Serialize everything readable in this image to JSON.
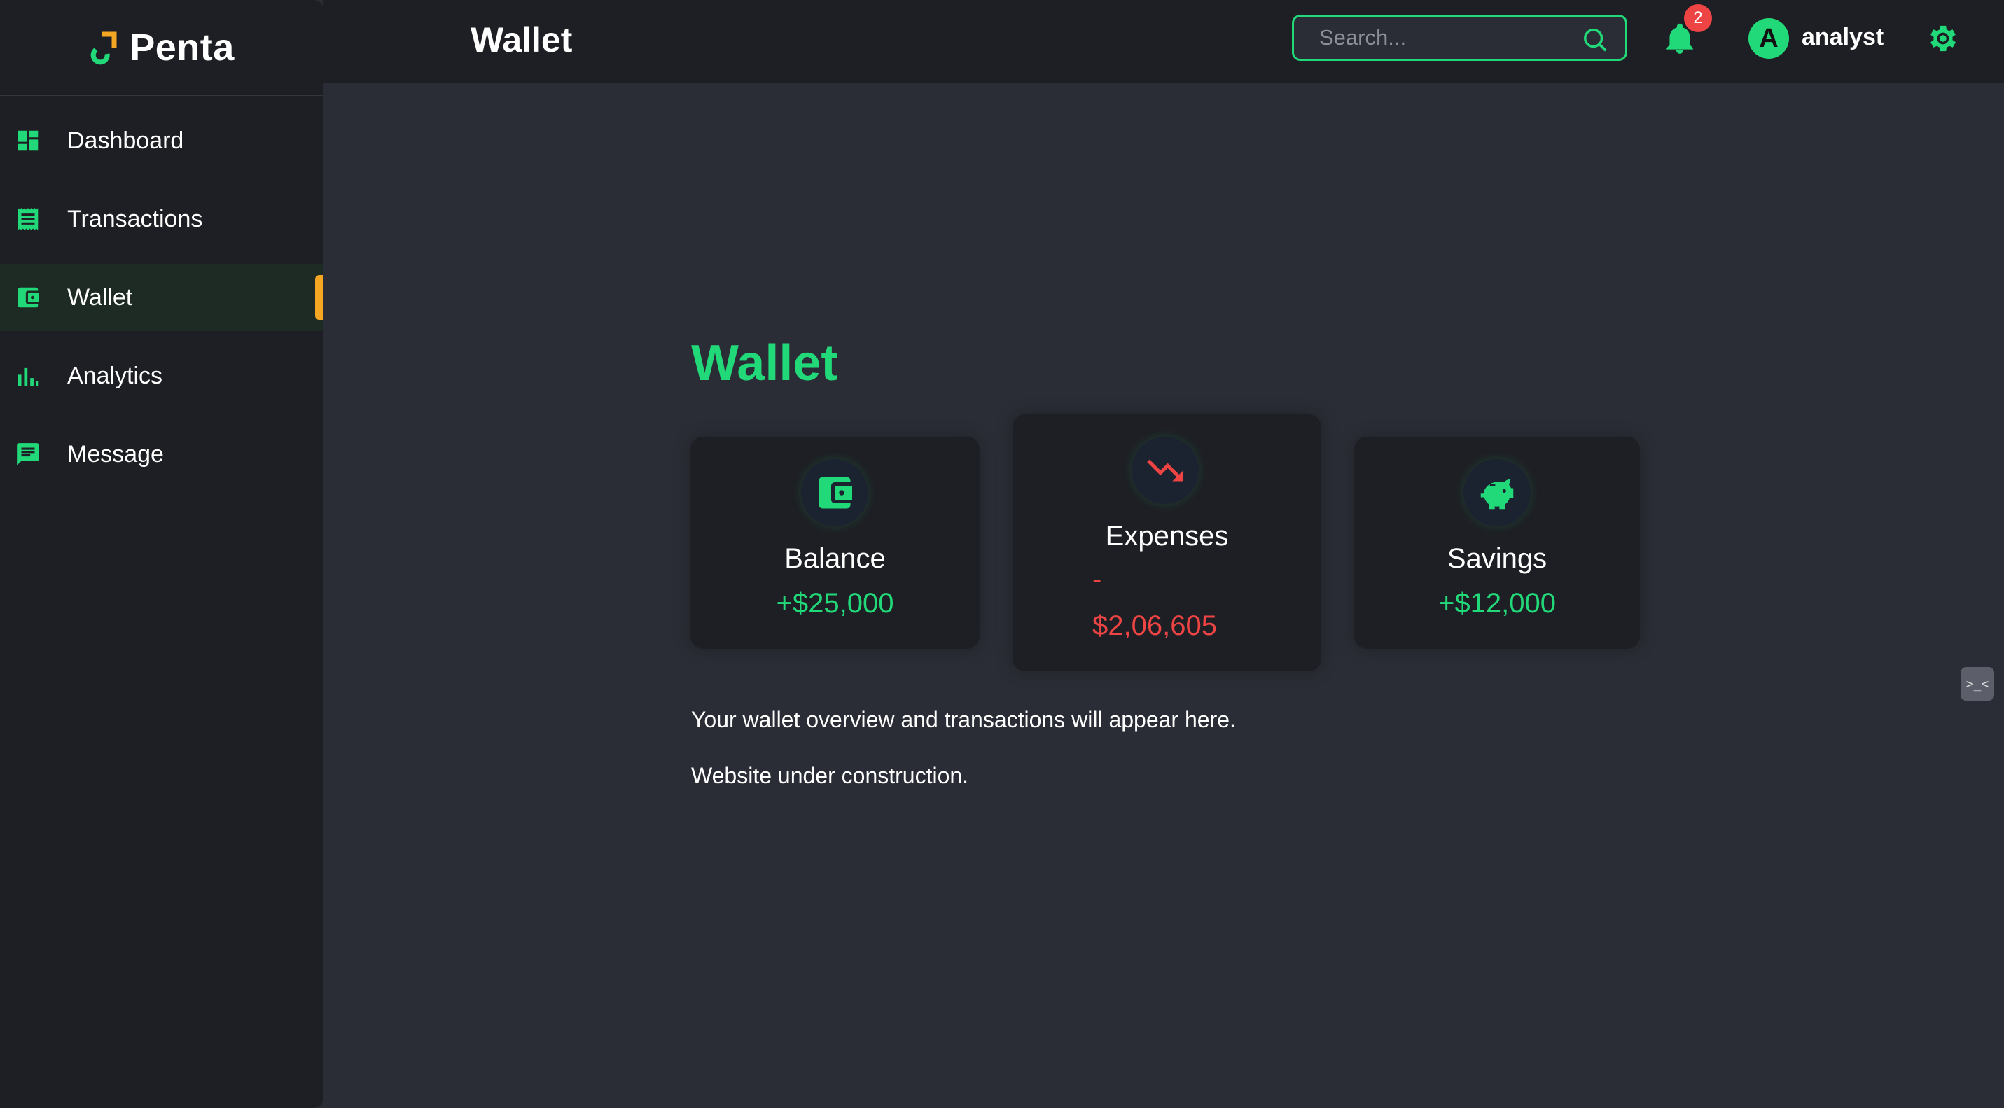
{
  "brand": {
    "name": "Penta"
  },
  "sidebar": {
    "items": [
      {
        "label": "Dashboard",
        "icon": "dashboard-icon",
        "active": false
      },
      {
        "label": "Transactions",
        "icon": "receipt-icon",
        "active": false
      },
      {
        "label": "Wallet",
        "icon": "wallet-icon",
        "active": true
      },
      {
        "label": "Analytics",
        "icon": "bar-chart-icon",
        "active": false
      },
      {
        "label": "Message",
        "icon": "message-icon",
        "active": false
      }
    ]
  },
  "header": {
    "title": "Wallet",
    "search_placeholder": "Search...",
    "notification_count": "2",
    "avatar_initial": "A",
    "username": "analyst"
  },
  "main": {
    "title": "Wallet",
    "cards": {
      "balance": {
        "title": "Balance",
        "value": "+$25,000",
        "icon": "wallet-icon"
      },
      "expenses": {
        "title": "Expenses",
        "sign": "-",
        "value": "$2,06,605",
        "icon": "trending-down-icon"
      },
      "savings": {
        "title": "Savings",
        "value": "+$12,000",
        "icon": "piggy-bank-icon"
      }
    },
    "overview_text": "Your wallet overview and transactions will appear here.",
    "construction_text": "Website under construction."
  },
  "colors": {
    "accent": "#22d979",
    "negative": "#ef4444",
    "active_indicator": "#f5a623",
    "sidebar_bg": "#1e1f24",
    "content_bg": "#2a2d35"
  }
}
